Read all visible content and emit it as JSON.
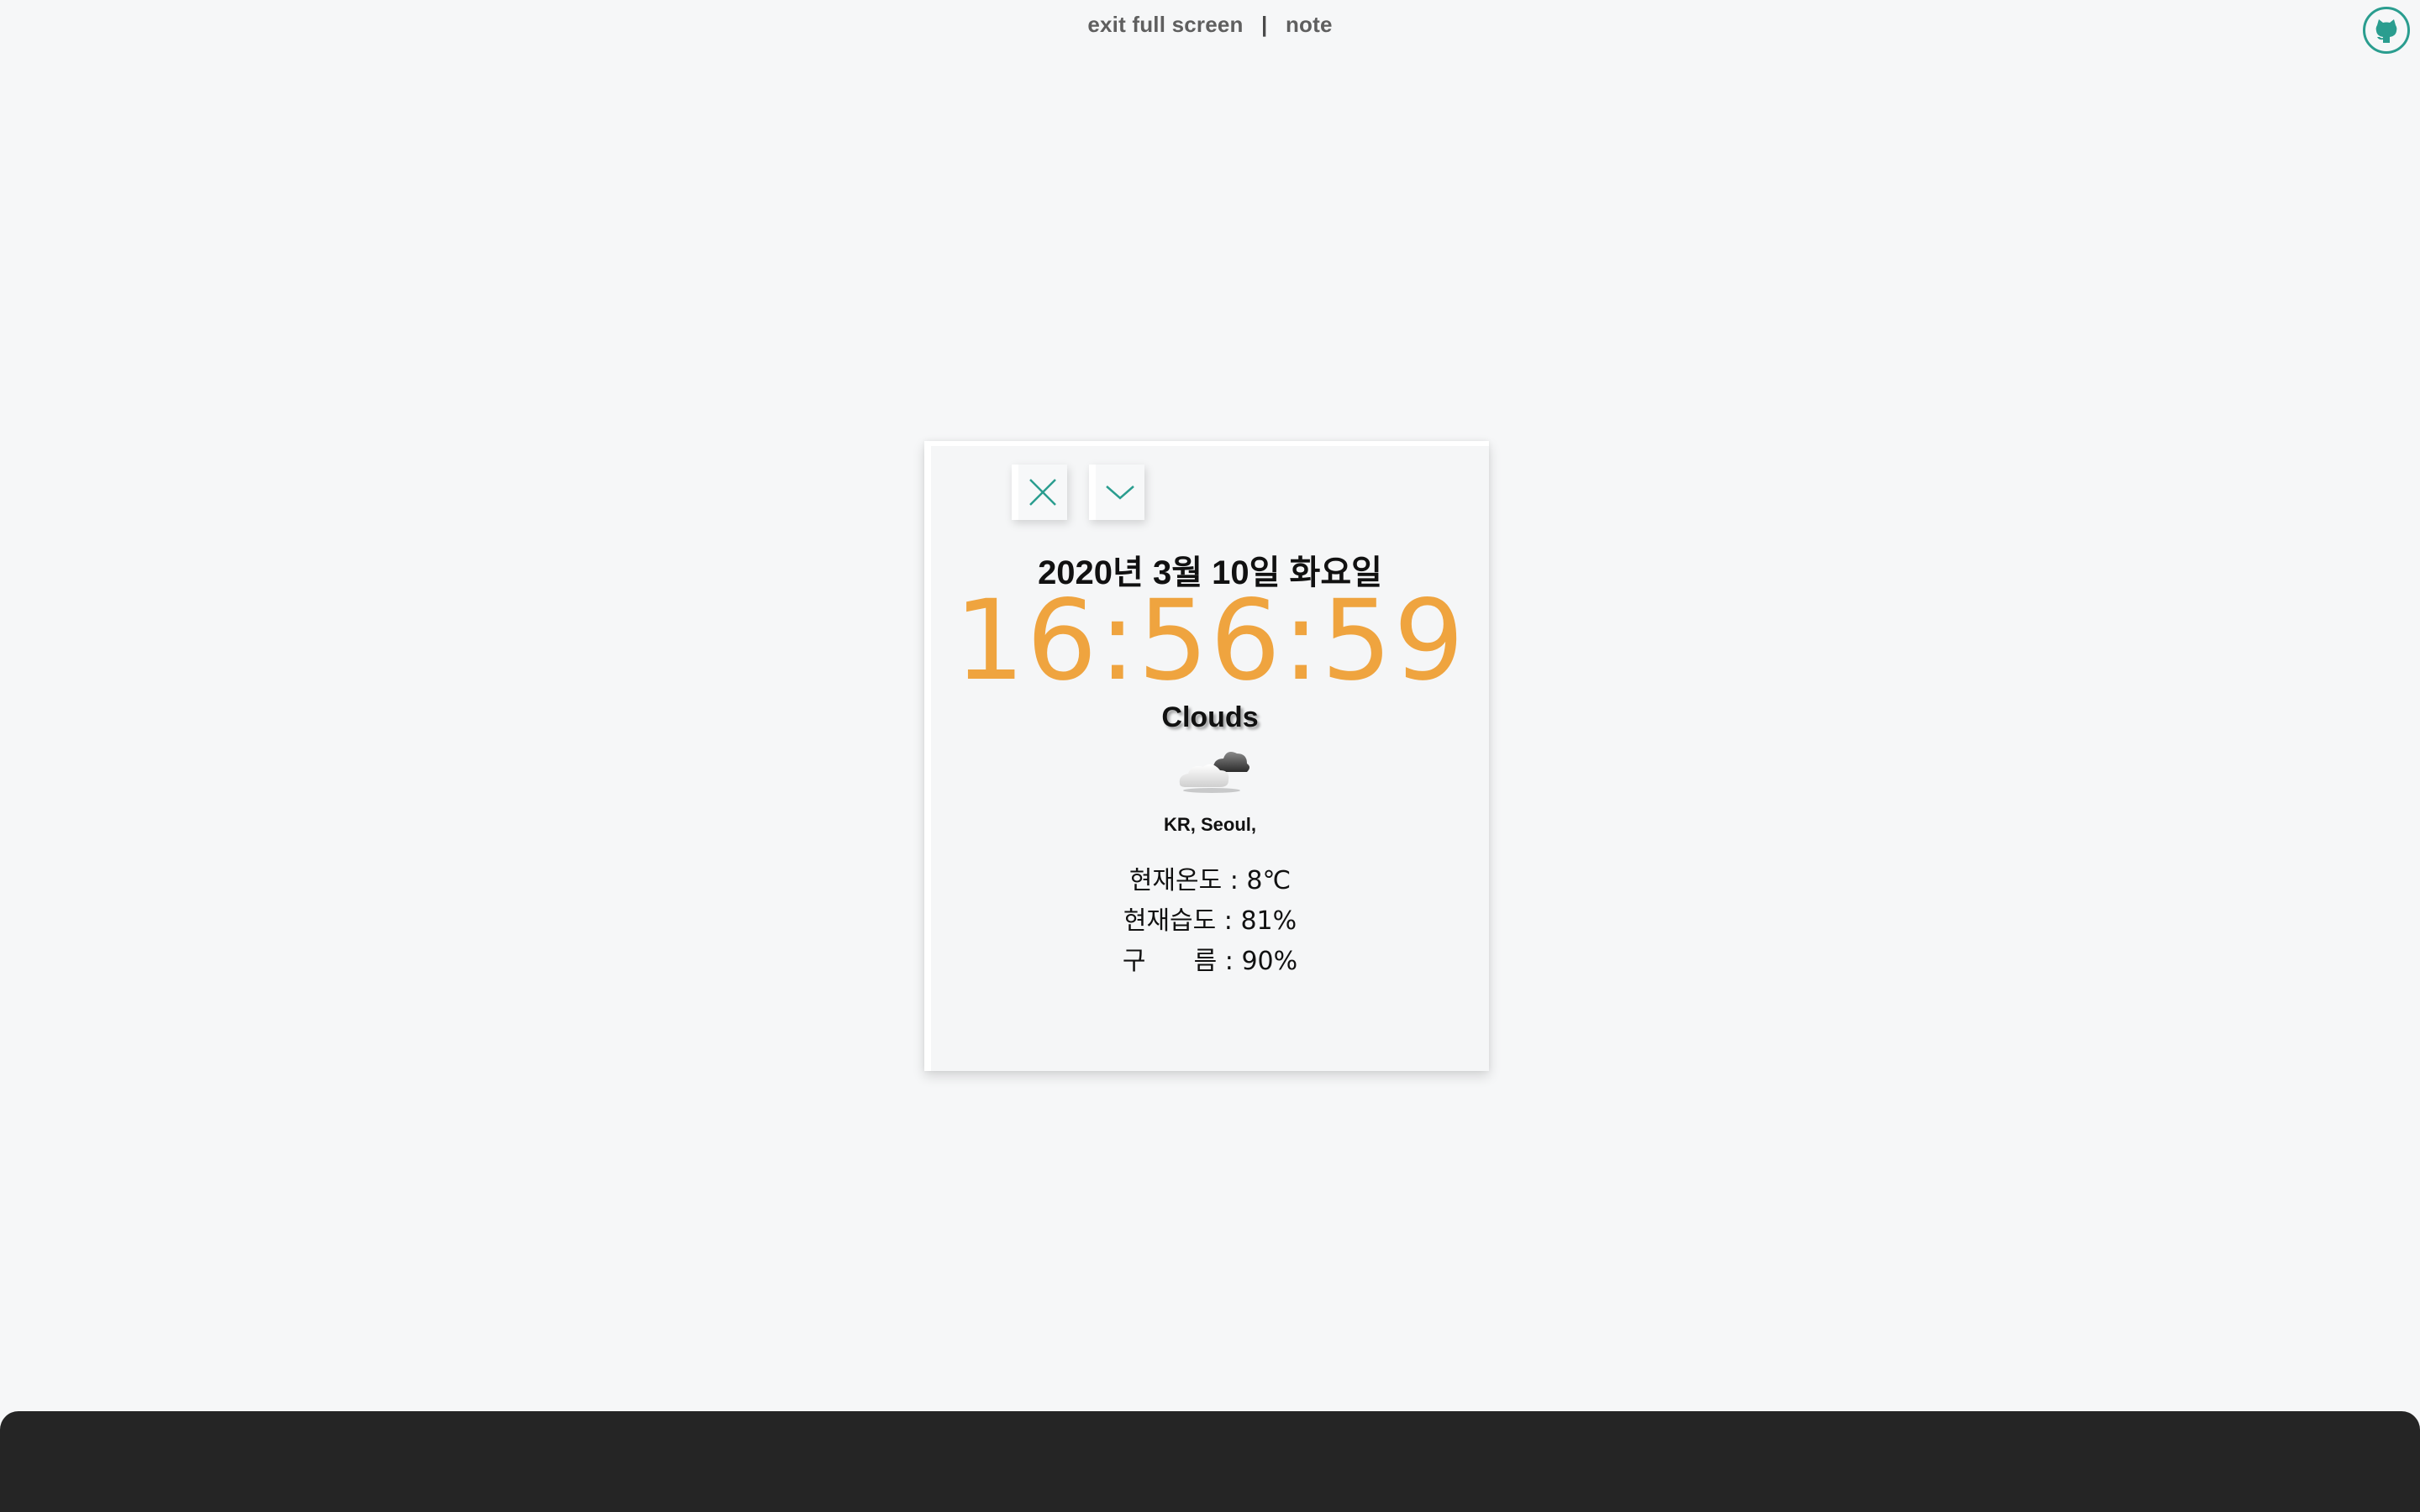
{
  "nav": {
    "exit_fullscreen": "exit full screen",
    "separator": "|",
    "note": "note"
  },
  "icons": {
    "github": "github-icon",
    "close": "close-icon",
    "collapse": "chevron-down-icon",
    "weather": "cloud-icon"
  },
  "widget": {
    "date": "2020년 3월 10일 화요일",
    "time": "16:56:59",
    "weather": "Clouds",
    "location": "KR, Seoul,",
    "temperature": "현재온도 : 8℃",
    "humidity": "현재습도 : 81%",
    "clouds": "구      름 : 90%"
  },
  "colors": {
    "background": "#f6f7f8",
    "accent_teal": "#2a9d8f",
    "clock_orange": "#efa43f",
    "bottom_bar": "#252525"
  }
}
